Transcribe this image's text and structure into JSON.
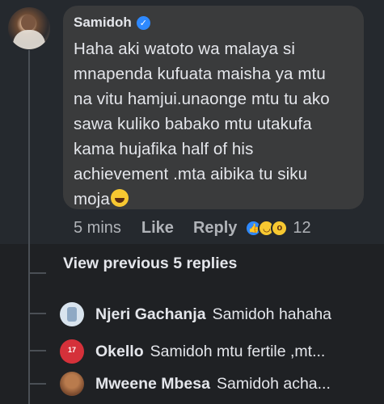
{
  "comment": {
    "author": "Samidoh",
    "verified_icon": "verified-badge-icon",
    "text": "Haha aki watoto wa malaya si\nmnapenda kufuata maisha ya mtu\nna vitu hamjui.unaonge mtu tu ako\nsawa kuliko babako mtu utakufa\nkama hujafika half of his\nachievement .mta aibika tu siku\nmoja",
    "emoji": "laughing-emoji-icon",
    "time": "5 mins",
    "like_label": "Like",
    "reply_label": "Reply",
    "reaction_icons": [
      "like-reaction-icon",
      "haha-reaction-icon",
      "wow-reaction-icon"
    ],
    "reaction_count": "12"
  },
  "thread": {
    "view_previous": "View previous 5 replies",
    "replies": [
      {
        "name": "Njeri Gachanja",
        "text": "Samidoh hahaha"
      },
      {
        "name": "Okello",
        "text": "Samidoh  mtu fertile ,mt...",
        "avatar_text": "17"
      },
      {
        "name": "Mweene Mbesa",
        "text": "Samidoh acha..."
      }
    ]
  },
  "colors": {
    "background": "#232930",
    "bubble": "#3a3b3c",
    "text": "#e4e6eb",
    "muted": "#b0b3b8",
    "accent": "#2e89ff"
  }
}
